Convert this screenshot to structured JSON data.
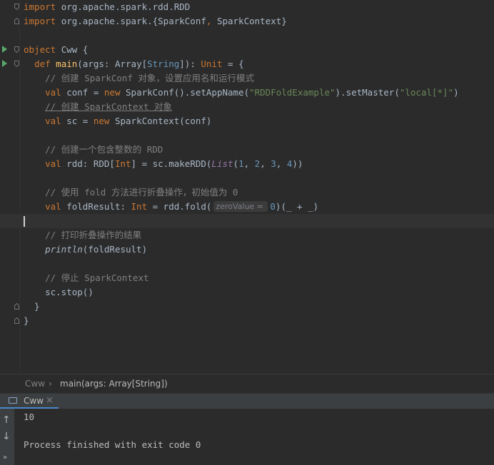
{
  "code_lines": [
    {
      "tokens": [
        [
          "kw",
          "import "
        ],
        [
          "",
          "org.apache.spark.rdd.RDD"
        ]
      ]
    },
    {
      "tokens": [
        [
          "kw",
          "import "
        ],
        [
          "",
          "org.apache.spark.{"
        ],
        [
          "",
          "SparkConf"
        ],
        [
          "kw",
          ", "
        ],
        [
          "",
          "SparkContext}"
        ]
      ]
    },
    {
      "tokens": []
    },
    {
      "tokens": [
        [
          "kw",
          "object "
        ],
        [
          "",
          "Cww {"
        ]
      ]
    },
    {
      "tokens": [
        [
          "",
          "  "
        ],
        [
          "kw",
          "def "
        ],
        [
          "fn",
          "main"
        ],
        [
          "",
          "(args: Array["
        ],
        [
          "ty",
          "String"
        ],
        [
          "",
          "]): "
        ],
        [
          "kw",
          "Unit"
        ],
        [
          "",
          " = {"
        ]
      ]
    },
    {
      "tokens": [
        [
          "",
          "    "
        ],
        [
          "cmt",
          "// 创建 SparkConf 对象，设置应用名和运行模式"
        ]
      ]
    },
    {
      "tokens": [
        [
          "",
          "    "
        ],
        [
          "kw",
          "val "
        ],
        [
          "",
          "conf = "
        ],
        [
          "kw",
          "new "
        ],
        [
          "",
          "SparkConf().setAppName("
        ],
        [
          "str",
          "\"RDDFoldExample\""
        ],
        [
          "",
          ").setMaster("
        ],
        [
          "str",
          "\"local[*]\""
        ],
        [
          "",
          ")"
        ]
      ]
    },
    {
      "tokens": [
        [
          "",
          "    "
        ],
        [
          "cmt ul",
          "// 创建 SparkContext 对象"
        ]
      ]
    },
    {
      "tokens": [
        [
          "",
          "    "
        ],
        [
          "kw",
          "val "
        ],
        [
          "",
          "sc = "
        ],
        [
          "kw",
          "new "
        ],
        [
          "",
          "SparkContext(conf)"
        ]
      ]
    },
    {
      "tokens": []
    },
    {
      "tokens": [
        [
          "",
          "    "
        ],
        [
          "cmt",
          "// 创建一个包含整数的 RDD"
        ]
      ]
    },
    {
      "tokens": [
        [
          "",
          "    "
        ],
        [
          "kw",
          "val "
        ],
        [
          "",
          "rdd: RDD["
        ],
        [
          "kw",
          "Int"
        ],
        [
          "",
          "] = sc.makeRDD("
        ],
        [
          "it",
          "List"
        ],
        [
          "",
          "("
        ],
        [
          "num",
          "1"
        ],
        [
          "",
          ", "
        ],
        [
          "num",
          "2"
        ],
        [
          "",
          ", "
        ],
        [
          "num",
          "3"
        ],
        [
          "",
          ", "
        ],
        [
          "num",
          "4"
        ],
        [
          "",
          "))"
        ]
      ]
    },
    {
      "tokens": []
    },
    {
      "tokens": [
        [
          "",
          "    "
        ],
        [
          "cmt",
          "// 使用 fold 方法进行折叠操作，初始值为 0"
        ]
      ]
    },
    {
      "tokens": [
        [
          "",
          "    "
        ],
        [
          "kw",
          "val "
        ],
        [
          "",
          "foldResult: "
        ],
        [
          "kw",
          "Int"
        ],
        [
          "",
          " = rdd.fold("
        ],
        [
          "hint",
          "zeroValue = "
        ],
        [
          "num",
          "0"
        ],
        [
          "",
          ")(_ + _)"
        ]
      ]
    },
    {
      "tokens": []
    },
    {
      "tokens": [
        [
          "",
          "    "
        ],
        [
          "cmt",
          "// 打印折叠操作的结果"
        ]
      ]
    },
    {
      "tokens": [
        [
          "",
          "    "
        ],
        [
          "itw",
          "println"
        ],
        [
          "",
          "(foldResult)"
        ]
      ]
    },
    {
      "tokens": []
    },
    {
      "tokens": [
        [
          "",
          "    "
        ],
        [
          "cmt",
          "// 停止 SparkContext"
        ]
      ]
    },
    {
      "tokens": [
        [
          "",
          "    "
        ],
        [
          "",
          "sc.stop()"
        ]
      ]
    },
    {
      "tokens": [
        [
          "",
          "  }"
        ]
      ]
    },
    {
      "tokens": [
        [
          "",
          "}"
        ]
      ]
    }
  ],
  "breadcrumb": {
    "item1": "Cww",
    "separator": "›",
    "item2": "main(args: Array[String])"
  },
  "run_tab": {
    "label": "Cww",
    "close": "×"
  },
  "console": {
    "output": "10",
    "status": "Process finished with exit code 0"
  },
  "colors": {
    "accent": "#4a88c7",
    "run_icon": "#59a869"
  }
}
